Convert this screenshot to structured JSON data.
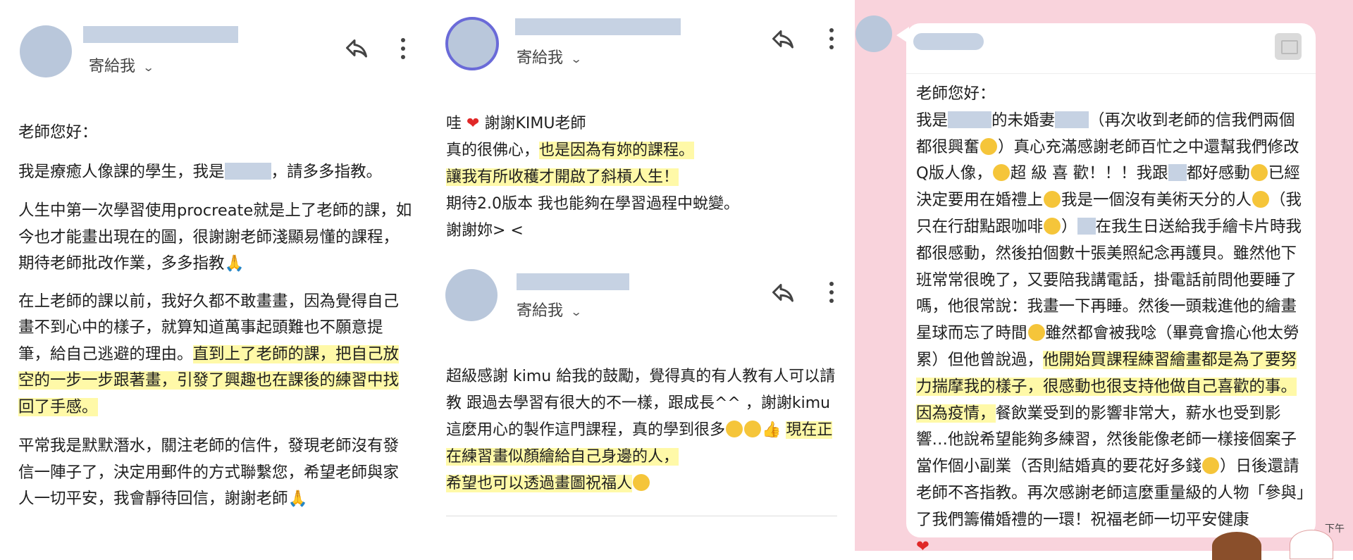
{
  "email1": {
    "sendto": "寄給我",
    "paragraphs": [
      "老師您好：",
      "我是療癒人像課的學生，我是",
      "，請多多指教。",
      "人生中第一次學習使用procreate就是上了老師的課，如今也才能畫出現在的圖，很謝謝老師淺顯易懂的課程，期待老師批改作業，多多指教",
      "在上老師的課以前，我好久都不敢畫畫，因為覺得自己畫不到心中的樣子，就算知道萬事起頭難也不願意提筆，給自己逃避的理由。",
      "直到上了老師的課，把自己放空的一步一步跟著畫，引發了興趣也在課後的練習中找回了手感。",
      "平常我是默默潛水，關注老師的信件，發現老師沒有發信一陣子了，決定用郵件的方式聯繫您，希望老師與家人一切平安，我會靜待回信，謝謝老師"
    ]
  },
  "email2": {
    "sendto": "寄給我",
    "lines": [
      "哇",
      "謝謝KIMU老師",
      "真的很佛心，",
      "也是因為有妳的課程。",
      "讓我有所收穫才開啟了斜槓人生！",
      "期待2.0版本 我也能夠在學習過程中蛻變。",
      "謝謝妳> <"
    ]
  },
  "email3": {
    "sendto": "寄給我",
    "lines": [
      "超級感謝 kimu 給我的鼓勵，覺得真的有人教有人可以請教 跟過去學習有很大的不一樣，跟成長^^ ，謝謝kimu這麼用心的製作這門課程，真的學到很多",
      "現在正在練習畫似顏繪給自己身邊的人，",
      "希望也可以透過畫圖祝福人"
    ]
  },
  "chat": {
    "lines": [
      "老師您好：",
      "我是",
      "的未婚妻",
      "（再次收到老師的信我們兩個都很興奮",
      "）真心充滿感謝老師百忙之中還幫我們修改Q版人像，",
      "超 級 喜 歡！！！我跟",
      "都好感動",
      "已經決定要用在婚禮上",
      "我是一個沒有美術天分的人",
      "（我只在行甜點跟咖啡",
      "）",
      "在我生日送給我手繪卡片時我都很感動，然後拍個數十張美照紀念再護貝。雖然他下班常常很晚了，又要陪我講電話，掛電話前問他要睡了嗎，他很常說：我畫一下再睡。然後一頭栽進他的繪畫星球而忘了時間",
      "雖然都會被我唸（畢竟會擔心他太勞累）但他曾說過，",
      "他開始買課程練習繪畫都是為了要努力揣摩我的樣子，很感動也很支持他做自己喜歡的事。因為疫情，",
      "餐飲業受到的影響非常大，薪水也受到影響…他說希望能夠多練習，然後能像老師一樣接個案子當作個小副業（否則結婚真的要花好多錢",
      "）日後還請老師不吝指教。再次感謝老師這麼重量級的人物「參與」了我們籌備婚禮的一環！祝福老師一切平安健康"
    ],
    "time": "下午"
  },
  "colors": {
    "highlight": "#fff9a8",
    "chat_bg": "#f9d3dc",
    "heart": "#e02828"
  },
  "icons": [
    "reply-icon",
    "more-vert-icon",
    "chevron-down-icon",
    "image-icon",
    "heart-icon",
    "emoji-icon"
  ]
}
